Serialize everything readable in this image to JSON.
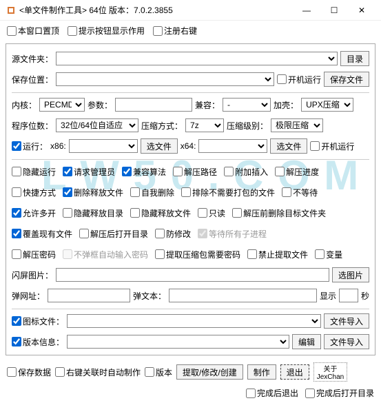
{
  "window": {
    "title": "<单文件制作工具> 64位 版本：7.0.2.3855"
  },
  "topchecks": {
    "pin": "本窗口置顶",
    "hint": "提示按钮显示作用",
    "regright": "注册右键"
  },
  "source": {
    "label": "源文件夹：",
    "btn": "目录"
  },
  "savepos": {
    "label": "保存位置：",
    "boot": "开机运行",
    "btn": "保存文件"
  },
  "kernel": {
    "label": "内核：",
    "value": "PECMD",
    "paramlabel": "参数：",
    "compatlabel": "兼容：",
    "compatval": "-",
    "shelllabel": "加壳：",
    "shellval": "UPX压缩"
  },
  "bits": {
    "label": "程序位数：",
    "value": "32位/64位自适应",
    "compresslabel": "压缩方式：",
    "compressval": "7z",
    "levellabel": "压缩级别：",
    "levelval": "极限压缩"
  },
  "run": {
    "label": "运行：",
    "x86": "x86:",
    "selectfile": "选文件",
    "x64": "x64:",
    "selectfile2": "选文件",
    "boot": "开机运行"
  },
  "opts": {
    "r1": [
      "隐藏运行",
      "请求管理员",
      "兼容算法",
      "解压路径",
      "附加插入",
      "解压进度"
    ],
    "r2": [
      "快捷方式",
      "删除释放文件",
      "自我删除",
      "排除不需要打包的文件",
      "不等待"
    ],
    "r3": [
      "允许多开",
      "隐藏释放目录",
      "隐藏释放文件",
      "只读",
      "解压前删除目标文件夹"
    ],
    "r4": [
      "覆盖现有文件",
      "解压后打开目录",
      "防修改",
      "等待所有子进程"
    ],
    "r5": [
      "解压密码",
      "不弹框自动输入密码",
      "提取压缩包需要密码",
      "禁止提取文件",
      "变量"
    ]
  },
  "flash": {
    "label": "闪屏图片：",
    "btn": "选图片"
  },
  "popup": {
    "urllabel": "弹网址：",
    "textlabel": "弹文本：",
    "showlabel": "显示",
    "secsuffix": "秒"
  },
  "iconfile": {
    "label": "图标文件：",
    "btn": "文件导入"
  },
  "verinfo": {
    "label": "版本信息：",
    "editbtn": "编辑",
    "importbtn": "文件导入"
  },
  "bottom": {
    "savedata": "保存数据",
    "rightauto": "右键关联时自动制作",
    "ver": "版本",
    "extract": "提取/修改/创建",
    "make": "制作",
    "exit": "退出",
    "about1": "关于",
    "about2": "JexChan",
    "exitafter": "完成后退出",
    "openafter": "完成后打开目录"
  },
  "watermark": "L W 5 0 . C O M"
}
